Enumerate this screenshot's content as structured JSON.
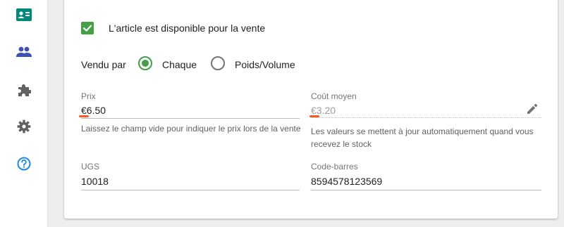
{
  "sidebar": {
    "items": [
      {
        "icon": "contact-card-icon",
        "color": "#00897b"
      },
      {
        "icon": "people-icon",
        "color": "#3f51b5"
      },
      {
        "icon": "puzzle-icon",
        "color": "#616161"
      },
      {
        "icon": "gear-icon",
        "color": "#616161"
      },
      {
        "icon": "help-circle-icon",
        "color": "#1e88e5"
      }
    ]
  },
  "form": {
    "available_label": "L'article est disponible pour la vente",
    "available_checked": true,
    "sold_by_label": "Vendu par",
    "sold_by_options": [
      {
        "label": "Chaque",
        "selected": true
      },
      {
        "label": "Poids/Volume",
        "selected": false
      }
    ],
    "price": {
      "label": "Prix",
      "value": "€6.50",
      "hint": "Laissez le champ vide pour indiquer le prix lors de la vente"
    },
    "avg_cost": {
      "label": "Coût moyen",
      "value": "€3.20",
      "hint": "Les valeurs se mettent à jour automatiquement quand vous recevez le stock"
    },
    "sku": {
      "label": "UGS",
      "value": "10018"
    },
    "barcode": {
      "label": "Code-barres",
      "value": "8594578123569"
    }
  },
  "colors": {
    "accent": "#43a047",
    "spellcheck": "#ff5722"
  }
}
